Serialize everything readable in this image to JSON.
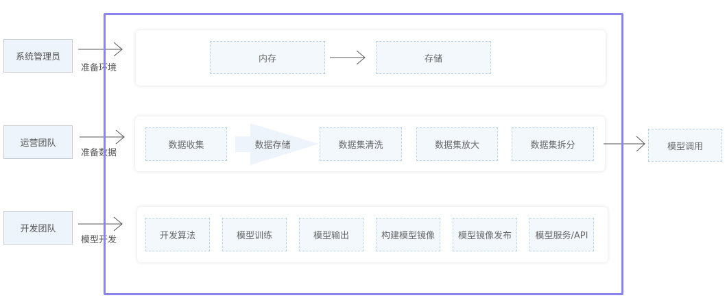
{
  "actors": [
    {
      "name": "系统管理员",
      "action": "准备环境"
    },
    {
      "name": "运营团队",
      "action": "准备数据"
    },
    {
      "name": "开发团队",
      "action": "模型开发"
    }
  ],
  "rows": {
    "environment": [
      "内存",
      "存储"
    ],
    "data": [
      "数据收集",
      "数据存储",
      "数据集清洗",
      "数据集放大",
      "数据集拆分"
    ],
    "development": [
      "开发算法",
      "模型训练",
      "模型输出",
      "构建模型镜像",
      "模型镜像发布",
      "模型服务/API"
    ]
  },
  "output": "模型调用"
}
